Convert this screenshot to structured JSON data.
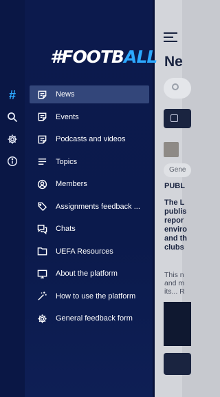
{
  "colors": {
    "drawer_bg": "#0c1a4d",
    "accent": "#2ca8ff",
    "active_item": "#33467a"
  },
  "logo": {
    "part1": "#FOOTB",
    "part2": "ALL"
  },
  "rail": [
    {
      "icon": "hashtag-icon",
      "glyph": "#"
    },
    {
      "icon": "search-icon"
    },
    {
      "icon": "gear-icon"
    },
    {
      "icon": "info-icon"
    }
  ],
  "menu": [
    {
      "label": "News",
      "icon": "note-icon",
      "active": true
    },
    {
      "label": "Events",
      "icon": "note-icon"
    },
    {
      "label": "Podcasts and videos",
      "icon": "note-icon"
    },
    {
      "label": "Topics",
      "icon": "lines-icon"
    },
    {
      "label": "Members",
      "icon": "user-circle-icon"
    },
    {
      "label": "Assignments feedback ...",
      "icon": "tag-icon"
    },
    {
      "label": "Chats",
      "icon": "chat-icon"
    },
    {
      "label": "UEFA Resources",
      "icon": "folder-icon"
    },
    {
      "label": "About the platform",
      "icon": "monitor-icon"
    },
    {
      "label": "How to use the platform",
      "icon": "magic-wand-icon"
    },
    {
      "label": "General feedback form",
      "icon": "gear-icon"
    }
  ],
  "background": {
    "title": "Ne",
    "chip": "Gene",
    "headline": "PUBL",
    "lead": "The L\npublis\nrepor\nenviro\nand th\nclubs",
    "body": "This n\nand m\nits... R"
  }
}
